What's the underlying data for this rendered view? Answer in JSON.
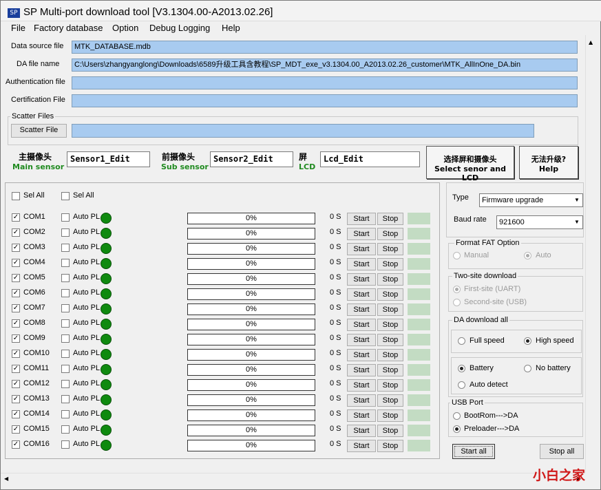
{
  "window": {
    "title": "SP Multi-port download tool [V3.1304.00-A2013.02.26]",
    "icon": "app-icon"
  },
  "menu": [
    "File",
    "Factory database",
    "Option",
    "Debug Logging",
    "Help"
  ],
  "files": {
    "data_source_label": "Data source file",
    "data_source_value": "MTK_DATABASE.mdb",
    "da_label": "DA file name",
    "da_value": "C:\\Users\\zhangyanglong\\Downloads\\6589升级工具含教程\\SP_MDT_exe_v3.1304.00_A2013.02.26_customer\\MTK_AllInOne_DA.bin",
    "auth_label": "Authentication file",
    "auth_value": "",
    "cert_label": "Certification File",
    "cert_value": ""
  },
  "scatter": {
    "group_title": "Scatter Files",
    "button": "Scatter File",
    "value": ""
  },
  "sensors": {
    "main_cn": "主摄像头",
    "main_en": "Main sensor",
    "main_edit": "Sensor1_Edit",
    "sub_cn": "前摄像头",
    "sub_en": "Sub sensor",
    "sub_edit": "Sensor2_Edit",
    "lcd_cn": "屏",
    "lcd_en": "LCD",
    "lcd_edit": "Lcd_Edit",
    "select_btn_cn": "选择屏和摄像头",
    "select_btn_en": "Select senor and LCD",
    "help_btn_cn": "无法升级?",
    "help_btn_en": "Help"
  },
  "ports_header": {
    "sel_all_1": "Sel All",
    "sel_all_2": "Sel All"
  },
  "ports": [
    {
      "name": "COM1",
      "checked": true,
      "auto": "Auto PL",
      "progress": "0%",
      "time": "0 S",
      "start": "Start",
      "stop": "Stop"
    },
    {
      "name": "COM2",
      "checked": true,
      "auto": "Auto PL",
      "progress": "0%",
      "time": "0 S",
      "start": "Start",
      "stop": "Stop"
    },
    {
      "name": "COM3",
      "checked": true,
      "auto": "Auto PL",
      "progress": "0%",
      "time": "0 S",
      "start": "Start",
      "stop": "Stop"
    },
    {
      "name": "COM4",
      "checked": true,
      "auto": "Auto PL",
      "progress": "0%",
      "time": "0 S",
      "start": "Start",
      "stop": "Stop"
    },
    {
      "name": "COM5",
      "checked": true,
      "auto": "Auto PL",
      "progress": "0%",
      "time": "0 S",
      "start": "Start",
      "stop": "Stop"
    },
    {
      "name": "COM6",
      "checked": true,
      "auto": "Auto PL",
      "progress": "0%",
      "time": "0 S",
      "start": "Start",
      "stop": "Stop"
    },
    {
      "name": "COM7",
      "checked": true,
      "auto": "Auto PL",
      "progress": "0%",
      "time": "0 S",
      "start": "Start",
      "stop": "Stop"
    },
    {
      "name": "COM8",
      "checked": true,
      "auto": "Auto PL",
      "progress": "0%",
      "time": "0 S",
      "start": "Start",
      "stop": "Stop"
    },
    {
      "name": "COM9",
      "checked": true,
      "auto": "Auto PL",
      "progress": "0%",
      "time": "0 S",
      "start": "Start",
      "stop": "Stop"
    },
    {
      "name": "COM10",
      "checked": true,
      "auto": "Auto PL",
      "progress": "0%",
      "time": "0 S",
      "start": "Start",
      "stop": "Stop"
    },
    {
      "name": "COM11",
      "checked": true,
      "auto": "Auto PL",
      "progress": "0%",
      "time": "0 S",
      "start": "Start",
      "stop": "Stop"
    },
    {
      "name": "COM12",
      "checked": true,
      "auto": "Auto PL",
      "progress": "0%",
      "time": "0 S",
      "start": "Start",
      "stop": "Stop"
    },
    {
      "name": "COM13",
      "checked": true,
      "auto": "Auto PL",
      "progress": "0%",
      "time": "0 S",
      "start": "Start",
      "stop": "Stop"
    },
    {
      "name": "COM14",
      "checked": true,
      "auto": "Auto PL",
      "progress": "0%",
      "time": "0 S",
      "start": "Start",
      "stop": "Stop"
    },
    {
      "name": "COM15",
      "checked": true,
      "auto": "Auto PL",
      "progress": "0%",
      "time": "0 S",
      "start": "Start",
      "stop": "Stop"
    },
    {
      "name": "COM16",
      "checked": true,
      "auto": "Auto PL",
      "progress": "0%",
      "time": "0 S",
      "start": "Start",
      "stop": "Stop"
    }
  ],
  "settings": {
    "type_label": "Type",
    "type_value": "Firmware upgrade",
    "baud_label": "Baud rate",
    "baud_value": "921600",
    "format_title": "Format FAT Option",
    "format_manual": "Manual",
    "format_auto": "Auto",
    "twosite_title": "Two-site download",
    "first_site": "First-site (UART)",
    "second_site": "Second-site (USB)",
    "da_title": "DA download all",
    "full_speed": "Full speed",
    "high_speed": "High speed",
    "battery": "Battery",
    "no_battery": "No battery",
    "auto_detect": "Auto detect",
    "usb_title": "USB Port",
    "bootrom": "BootRom--->DA",
    "preloader": "Preloader--->DA",
    "start_all": "Start all",
    "stop_all": "Stop all"
  },
  "watermark": "小白之家",
  "colors": {
    "led": "#0f8a0f",
    "field": "#a8cbf0",
    "status_box": "#c3dcc3",
    "watermark": "#d01818"
  }
}
